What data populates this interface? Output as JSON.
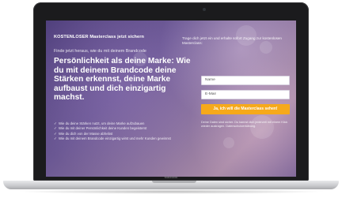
{
  "device": {
    "brand_label": "MacBook"
  },
  "landing": {
    "top_title": "KOSTENLOSER Masterclass jetzt sichern",
    "intro": "Finde jetzt heraus, wie du mit deinem Brandcode",
    "headline": "Persönlichkeit als deine Marke: Wie du mit deinem Brandcode deine Stärken erkennst, deine Marke aufbaust und dich einzigartig machst.",
    "bullets": [
      "Wie du deine Stärken nutzt, um deine Marke aufzubauen",
      "Wie du mit deiner Persönlichkeit deine Kunden begeisterst",
      "Wie du dich von der Masse abhebst",
      "Wie du mit deinem Brandcode einzigartig wirst und mehr Kunden gewinnst"
    ],
    "right_intro": "Trage dich jetzt ein und erhalte sofort Zugang zur kostenlosen Masterclass:",
    "form": {
      "name_placeholder": "Name",
      "email_placeholder": "E-Mail",
      "cta_label": "Ja, ich will die Masterclass sehen!"
    },
    "privacy_note": "Deine Daten sind sicher. Du kannst dich jederzeit mit einem Klick wieder austragen. Datenschutzerklärung."
  },
  "colors": {
    "cta": "#f6a91a",
    "background_start": "#4f3f7c",
    "background_end": "#a88aa6"
  }
}
